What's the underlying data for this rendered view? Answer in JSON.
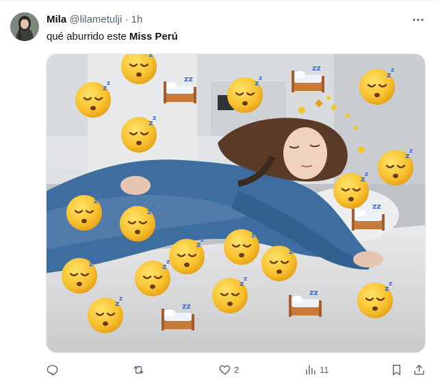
{
  "tweet": {
    "author_name": "Mila",
    "handle": "@lilametulji",
    "separator": "·",
    "time": "1h",
    "text_plain": "qué aburrido este ",
    "text_bold": "Miss Perú"
  },
  "actions": {
    "replies": "",
    "retweets": "",
    "likes": "2",
    "views": "11"
  },
  "icons": {
    "more": "more-horizontal-icon",
    "reply": "reply-icon",
    "retweet": "retweet-icon",
    "like": "heart-icon",
    "views": "views-chart-icon",
    "bookmark": "bookmark-icon",
    "share": "share-icon"
  },
  "colors": {
    "text_primary": "#0f1419",
    "text_secondary": "#536471"
  }
}
